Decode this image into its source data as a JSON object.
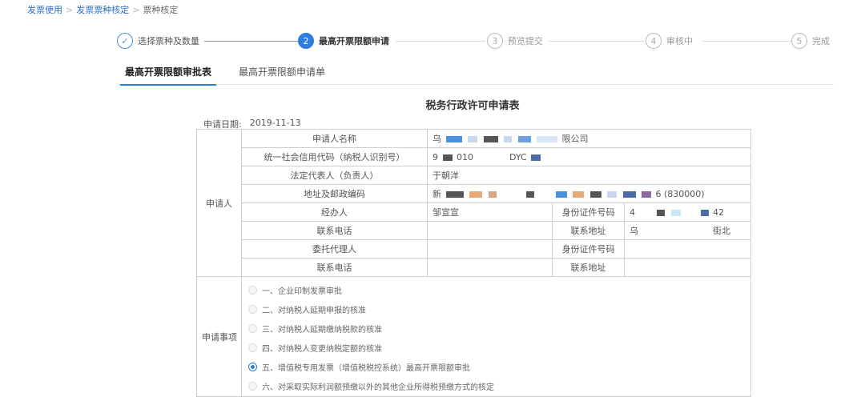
{
  "breadcrumb": {
    "items": [
      "发票使用",
      "发票票种核定",
      "票种核定"
    ]
  },
  "steps": [
    {
      "num": "✓",
      "label": "选择票种及数量"
    },
    {
      "num": "2",
      "label": "最高开票限额申请"
    },
    {
      "num": "3",
      "label": "预览提交"
    },
    {
      "num": "4",
      "label": "审核中"
    },
    {
      "num": "5",
      "label": "完成"
    }
  ],
  "tabs": [
    {
      "label": "最高开票限额审批表"
    },
    {
      "label": "最高开票限额申请单"
    }
  ],
  "form": {
    "title": "税务行政许可申请表",
    "date_label": "申请日期:",
    "date_value": "2019-11-13",
    "group_applicant": "申请人",
    "group_matter": "申请事项",
    "rows": {
      "name_label": "申请人名称",
      "name_prefix": "乌",
      "name_suffix": "限公司",
      "credit_label": "统一社会信用代码（纳税人识别号）",
      "credit_a": "9",
      "credit_b": "010",
      "credit_c": "DYC",
      "legal_label": "法定代表人（负责人）",
      "legal_value": "于朝洋",
      "address_label": "地址及邮政编码",
      "address_prefix": "新",
      "address_code": "6 (830000)",
      "handler_label": "经办人",
      "handler_value": "邹宣宣",
      "id_label": "身份证件号码",
      "id_prefix": "4",
      "id_suffix": "42",
      "phone_label": "联系电话",
      "contact_addr_label": "联系地址",
      "contact_addr_prefix": "乌",
      "contact_addr_suffix": "街北",
      "agent_label": "委托代理人",
      "agent_id_label": "身份证件号码",
      "agent_phone_label": "联系电话",
      "agent_addr_label": "联系地址"
    },
    "options": [
      {
        "label": "一、企业印制发票审批",
        "checked": false
      },
      {
        "label": "二、对纳税人延期申报的核准",
        "checked": false
      },
      {
        "label": "三、对纳税人延期缴纳税款的核准",
        "checked": false
      },
      {
        "label": "四、对纳税人变更纳税定额的核准",
        "checked": false
      },
      {
        "label": "五、增值税专用发票（增值税税控系统）最高开票限额审批",
        "checked": true
      },
      {
        "label": "六、对采取实际利润额预缴以外的其他企业所得税预缴方式的核定",
        "checked": false
      }
    ]
  },
  "colors": {
    "accent": "#2f7ce0",
    "link": "#2b6cc4",
    "mask_blue": "#4a8fe0",
    "mask_gray": "#555555",
    "mask_orange": "#e8a878",
    "mask_light": "#c8d8f0"
  }
}
